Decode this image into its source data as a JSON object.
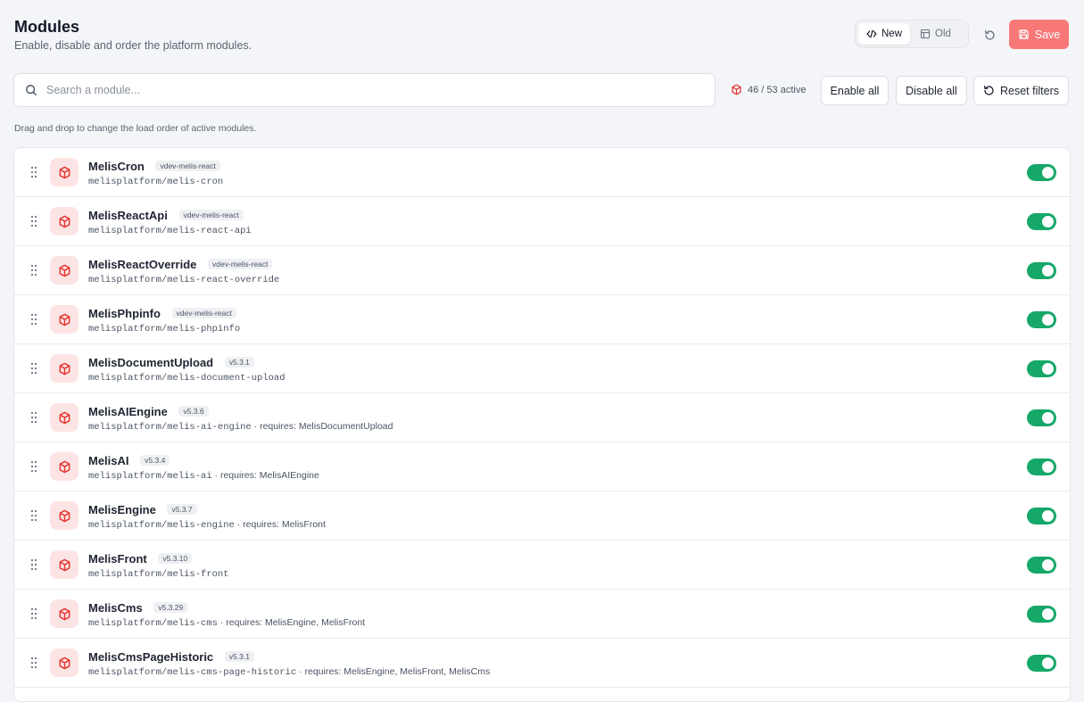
{
  "header": {
    "title": "Modules",
    "subtitle": "Enable, disable and order the platform modules."
  },
  "view_toggle": {
    "new_label": "New",
    "old_label": "Old",
    "active": "New"
  },
  "toolbar": {
    "save_label": "Save",
    "search_placeholder": "Search a module...",
    "active_count": "46 / 53 active",
    "enable_all_label": "Enable all",
    "disable_all_label": "Disable all",
    "reset_filters_label": "Reset filters",
    "hint": "Drag and drop to change the load order of active modules."
  },
  "colors": {
    "accent_red": "#f87878",
    "icon_red": "#e53935",
    "toggle_green": "#16a869"
  },
  "modules": [
    {
      "name": "MelisCron",
      "version": "vdev-melis-react",
      "package": "melisplatform/melis-cron",
      "requires": "",
      "enabled": true
    },
    {
      "name": "MelisReactApi",
      "version": "vdev-melis-react",
      "package": "melisplatform/melis-react-api",
      "requires": "",
      "enabled": true
    },
    {
      "name": "MelisReactOverride",
      "version": "vdev-melis-react",
      "package": "melisplatform/melis-react-override",
      "requires": "",
      "enabled": true
    },
    {
      "name": "MelisPhpinfo",
      "version": "vdev-melis-react",
      "package": "melisplatform/melis-phpinfo",
      "requires": "",
      "enabled": true
    },
    {
      "name": "MelisDocumentUpload",
      "version": "v5.3.1",
      "package": "melisplatform/melis-document-upload",
      "requires": "",
      "enabled": true
    },
    {
      "name": "MelisAIEngine",
      "version": "v5.3.6",
      "package": "melisplatform/melis-ai-engine",
      "requires": "· requires: MelisDocumentUpload",
      "enabled": true
    },
    {
      "name": "MelisAI",
      "version": "v5.3.4",
      "package": "melisplatform/melis-ai",
      "requires": "· requires: MelisAIEngine",
      "enabled": true
    },
    {
      "name": "MelisEngine",
      "version": "v5.3.7",
      "package": "melisplatform/melis-engine",
      "requires": "· requires: MelisFront",
      "enabled": true
    },
    {
      "name": "MelisFront",
      "version": "v5.3.10",
      "package": "melisplatform/melis-front",
      "requires": "",
      "enabled": true
    },
    {
      "name": "MelisCms",
      "version": "v5.3.29",
      "package": "melisplatform/melis-cms",
      "requires": "· requires: MelisEngine, MelisFront",
      "enabled": true
    },
    {
      "name": "MelisCmsPageHistoric",
      "version": "v5.3.1",
      "package": "melisplatform/melis-cms-page-historic",
      "requires": "· requires: MelisEngine, MelisFront, MelisCms",
      "enabled": true
    }
  ]
}
